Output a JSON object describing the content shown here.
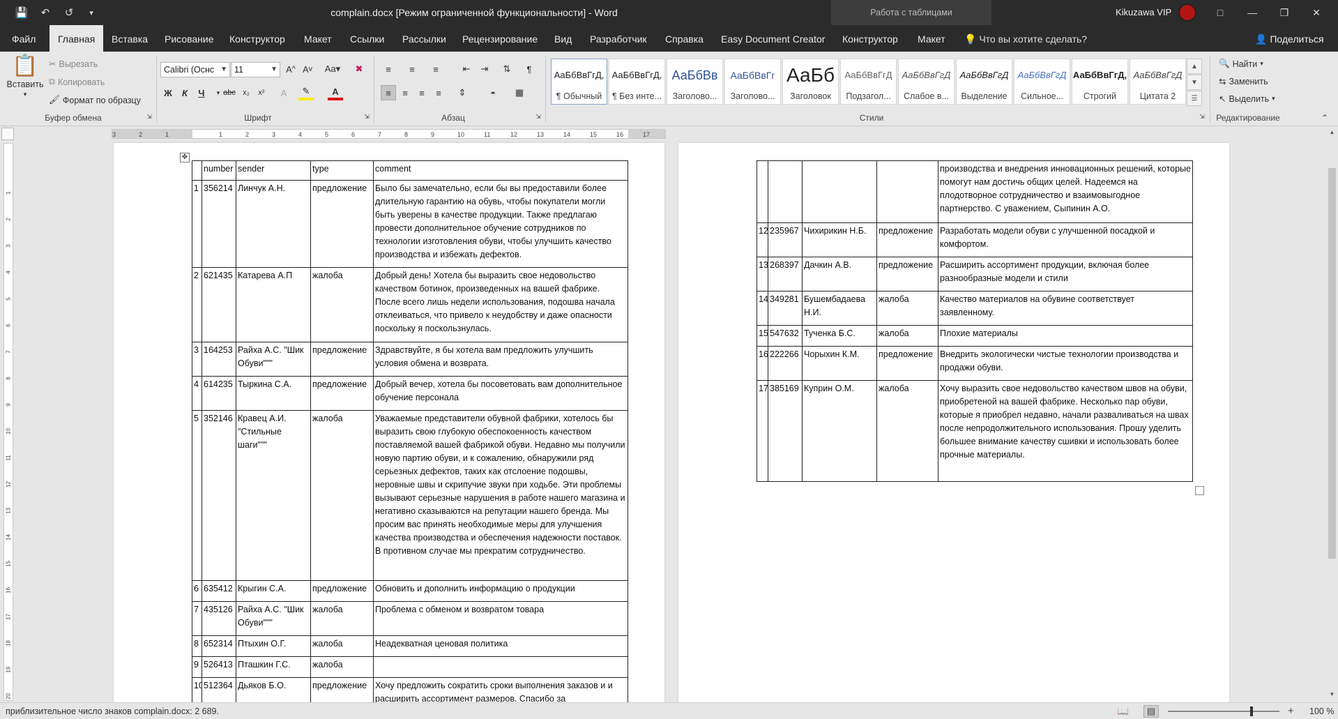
{
  "titlebar": {
    "doc_title": "complain.docx [Режим ограниченной функциональности]  -  Word",
    "context_tab": "Работа с таблицами",
    "user_name": "Kikuzawa VIP"
  },
  "tabs": [
    "Файл",
    "Главная",
    "Вставка",
    "Рисование",
    "Конструктор",
    "Макет",
    "Ссылки",
    "Рассылки",
    "Рецензирование",
    "Вид",
    "Разработчик",
    "Справка",
    "Easy Document Creator",
    "Конструктор",
    "Макет"
  ],
  "tell_me": "Что вы хотите сделать?",
  "share": "Поделиться",
  "clipboard": {
    "paste": "Вставить",
    "cut": "Вырезать",
    "copy": "Копировать",
    "format_painter": "Формат по образцу",
    "group": "Буфер обмена"
  },
  "font": {
    "name": "Calibri (Оснс",
    "size": "11",
    "group": "Шрифт"
  },
  "paragraph": {
    "group": "Абзац"
  },
  "styles": {
    "group": "Стили",
    "items": [
      {
        "preview": "АаБбВвГгД,",
        "name": "¶ Обычный"
      },
      {
        "preview": "АаБбВвГгД,",
        "name": "¶ Без инте..."
      },
      {
        "preview": "АаБбВв",
        "name": "Заголово..."
      },
      {
        "preview": "АаБбВвГг",
        "name": "Заголово..."
      },
      {
        "preview": "АаБб",
        "name": "Заголовок"
      },
      {
        "preview": "АаБбВвГгД",
        "name": "Подзагол..."
      },
      {
        "preview": "АаБбВвГгД",
        "name": "Слабое в..."
      },
      {
        "preview": "АаБбВвГгД",
        "name": "Выделение"
      },
      {
        "preview": "АаБбВвГгД",
        "name": "Сильное..."
      },
      {
        "preview": "АаБбВвГгД,",
        "name": "Строгий"
      },
      {
        "preview": "АаБбВвГгД",
        "name": "Цитата 2"
      }
    ]
  },
  "editing": {
    "group": "Редактирование",
    "find": "Найти",
    "replace": "Заменить",
    "select": "Выделить"
  },
  "ruler_numbers": [
    "3",
    "2",
    "1",
    "1",
    "2",
    "3",
    "4",
    "5",
    "6",
    "7",
    "8",
    "9",
    "10",
    "11",
    "12",
    "13",
    "14",
    "15",
    "16",
    "17"
  ],
  "vruler_numbers": [
    "1",
    "2",
    "3",
    "4",
    "5",
    "6",
    "7",
    "8",
    "9",
    "10",
    "11",
    "12",
    "13",
    "14",
    "15",
    "16",
    "17",
    "18",
    "19",
    "20"
  ],
  "table_left": {
    "header": [
      "",
      "number",
      "sender",
      "type",
      "comment"
    ],
    "rows": [
      [
        "1",
        "356214",
        "Линчук А.Н.",
        "предложение",
        "Было бы замечательно, если бы вы предоставили более длительную гарантию на обувь, чтобы покупатели могли быть уверены в качестве продукции. Также предлагаю провести дополнительное обучение сотрудников по технологии изготовления обуви, чтобы улучшить качество производства и избежать дефектов."
      ],
      [
        "2",
        "621435",
        "Катарева А.П",
        "жалоба",
        "Добрый день! Хотела бы выразить свое недовольство качеством ботинок, произведенных на вашей фабрике. После всего лишь недели использования, подошва начала отклеиваться, что привело к неудобству и даже опасности поскольку я поскользнулась."
      ],
      [
        "3",
        "164253",
        "Райха А.С. \"Шик Обуви\"\"\"",
        "предложение",
        "Здравствуйте, я бы хотела вам предложить улучшить условия обмена и возврата."
      ],
      [
        "4",
        "614235",
        "Тыркина С.А.",
        "предложение",
        "Добрый вечер, хотела бы посоветовать вам дополнительное обучение персонала"
      ],
      [
        "5",
        "352146",
        "Кравец А.И. \"Стильные шаги\"\"\"",
        "жалоба",
        "Уважаемые представители обувной фабрики, хотелось бы выразить свою глубокую обеспокоенность качеством поставляемой вашей фабрикой обуви. Недавно мы получили новую партию обуви, и к сожалению, обнаружили ряд серьезных дефектов, таких как отслоение подошвы, неровные швы и скрипучие звуки при ходьбе. Эти проблемы вызывают серьезные нарушения в работе нашего магазина и негативно сказываются на репутации нашего бренда. Мы просим вас принять необходимые меры для улучшения качества производства и обеспечения надежности поставок. В противном случае мы прекратим сотрудничество."
      ],
      [
        "6",
        "635412",
        "Крыгин С.А.",
        "предложение",
        "Обновить и дополнить информацию о продукции"
      ],
      [
        "7",
        "435126",
        "Райха А.С. \"Шик Обуви\"\"\"",
        "жалоба",
        "Проблема с обменом и возвратом товара"
      ],
      [
        "8",
        "652314",
        "Птыхин О.Г.",
        "жалоба",
        "Неадекватная ценовая политика"
      ],
      [
        "9",
        "526413",
        "Пташкин Г.С.",
        "жалоба",
        ""
      ],
      [
        "10",
        "512364",
        "Дьяков Б.О.",
        "предложение",
        "Хочу предложить сократить сроки выполнения заказов и и расширить ассортимент размеров. Спасибо за"
      ]
    ]
  },
  "table_right": {
    "rows": [
      [
        "",
        "",
        "",
        "",
        "производства и внедрения инновационных решений, которые помогут нам достичь общих целей. Надеемся на плодотворное сотрудничество и взаимовыгодное партнерство. С уважением, Сыпинин А.О."
      ],
      [
        "12",
        "235967",
        "Чихирикин Н.Б.",
        "предложение",
        "Разработать модели обуви с улучшенной посадкой и комфортом."
      ],
      [
        "13",
        "268397",
        "Дачкин А.В.",
        "предложение",
        "Расширить ассортимент продукции, включая более разнообразные модели и стили"
      ],
      [
        "14",
        "349281",
        "Бушембадаева Н.И.",
        "жалоба",
        "Качество материалов на обувине соответствует заявленному."
      ],
      [
        "15",
        "547632",
        "Тученка Б.С.",
        "жалоба",
        "Плохие материалы"
      ],
      [
        "16",
        "222266",
        "Чорыхин К.М.",
        "предложение",
        "Внедрить экологически чистые технологии производства и продажи обуви."
      ],
      [
        "17",
        "385169",
        "Куприн О.М.",
        "жалоба",
        "Хочу выразить свое недовольство качеством швов на обуви, приобретеной на вашей фабрике. Несколько пар обуви, которые я приобрел недавно, начали разваливаться на швах после непродолжительного использования. Прошу уделить большее внимание качеству сшивки и использовать более прочные материалы."
      ]
    ]
  },
  "status": {
    "word_count": "приблизительное число знаков complain.docx: 2 689.",
    "zoom": "100 %"
  }
}
